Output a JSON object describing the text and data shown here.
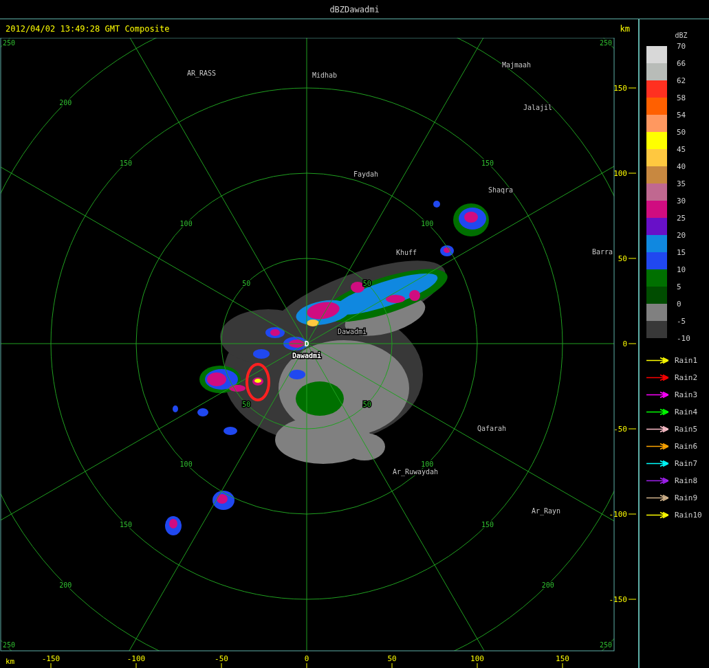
{
  "window": {
    "title": "dBZDawadmi"
  },
  "plot": {
    "timestamp": "2012/04/02 13:49:28 GMT Composite",
    "unit_label": "km",
    "range_rings": [
      {
        "labels": {
          "nw": "50",
          "ne": "50",
          "sw": "50",
          "se": "50"
        }
      },
      {
        "labels": {
          "nw": "100",
          "ne": "100",
          "sw": "100",
          "se": "100"
        }
      },
      {
        "labels": {
          "nw": "150",
          "ne": "150",
          "sw": "150",
          "se": "150"
        }
      },
      {
        "labels": {
          "nw": "200",
          "sw": "200",
          "se": "200"
        }
      },
      {
        "labels": {
          "nw": "250",
          "ne": "250",
          "sw": "250",
          "se": "250"
        }
      }
    ],
    "site_marker": "D",
    "places": [
      {
        "name": "AR_RASS",
        "kind": "town"
      },
      {
        "name": "Midhab",
        "kind": "town"
      },
      {
        "name": "Majmaah",
        "kind": "town"
      },
      {
        "name": "Jalajil",
        "kind": "town"
      },
      {
        "name": "Faydah",
        "kind": "town"
      },
      {
        "name": "Shaqra",
        "kind": "town"
      },
      {
        "name": "Khuff",
        "kind": "town"
      },
      {
        "name": "Barra",
        "kind": "town"
      },
      {
        "name": "Dawadmi",
        "kind": "town"
      },
      {
        "name": "Dawadmi",
        "kind": "site"
      },
      {
        "name": "Qafarah",
        "kind": "town"
      },
      {
        "name": "Ar_Ruwaydah",
        "kind": "town"
      },
      {
        "name": "Ar_Rayn",
        "kind": "town"
      }
    ],
    "y_axis": {
      "ticks": [
        "150",
        "100",
        "50",
        "0",
        "-50",
        "-100",
        "-150"
      ]
    },
    "x_axis": {
      "unit": "km",
      "ticks": [
        "-150",
        "-100",
        "-50",
        "0",
        "50",
        "100",
        "150"
      ]
    }
  },
  "legend": {
    "title": "dBZ",
    "labels": [
      "70",
      "66",
      "62",
      "58",
      "54",
      "50",
      "45",
      "40",
      "35",
      "30",
      "25",
      "20",
      "15",
      "10",
      "5",
      "0",
      "-5",
      "-10"
    ],
    "swatches": [
      {
        "color": "#d8d8d8"
      },
      {
        "color": "#b8bcb8"
      },
      {
        "color": "#ff3020"
      },
      {
        "color": "#ff6000"
      },
      {
        "color": "#ff9860"
      },
      {
        "color": "#ffff00"
      },
      {
        "color": "#ffc840"
      },
      {
        "color": "#c88840"
      },
      {
        "color": "#c06890"
      },
      {
        "color": "#d00c80"
      },
      {
        "color": "#6810c8"
      },
      {
        "color": "#1088e0"
      },
      {
        "color": "#2048f0"
      },
      {
        "color": "#007000"
      },
      {
        "color": "#004c00"
      },
      {
        "color": "#808080"
      },
      {
        "color": "#383838"
      }
    ]
  },
  "rain_tracks": [
    {
      "label": "Rain1",
      "color": "#ffff00"
    },
    {
      "label": "Rain2",
      "color": "#ff0000"
    },
    {
      "label": "Rain3",
      "color": "#ff00ff"
    },
    {
      "label": "Rain4",
      "color": "#00ff00"
    },
    {
      "label": "Rain5",
      "color": "#ffc0cb"
    },
    {
      "label": "Rain6",
      "color": "#ffa500"
    },
    {
      "label": "Rain7",
      "color": "#00ffff"
    },
    {
      "label": "Rain8",
      "color": "#a020f0"
    },
    {
      "label": "Rain9",
      "color": "#d2b48c"
    },
    {
      "label": "Rain10",
      "color": "#ffff00"
    }
  ]
}
